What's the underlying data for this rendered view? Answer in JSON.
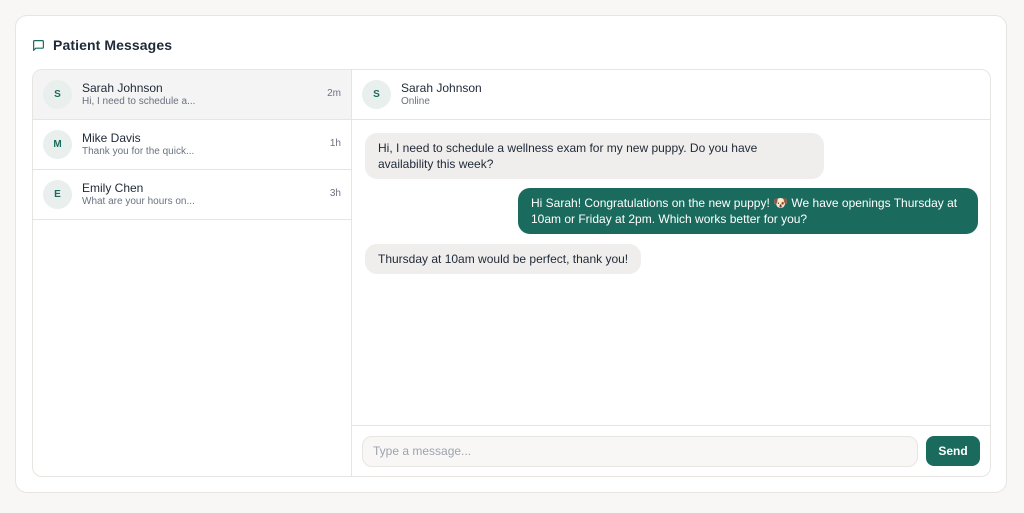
{
  "header": {
    "title": "Patient Messages",
    "icon": "message-square-icon"
  },
  "conversations": [
    {
      "initial": "S",
      "name": "Sarah Johnson",
      "preview": "Hi, I need to schedule a...",
      "time": "2m",
      "active": true
    },
    {
      "initial": "M",
      "name": "Mike Davis",
      "preview": "Thank you for the quick...",
      "time": "1h",
      "active": false
    },
    {
      "initial": "E",
      "name": "Emily Chen",
      "preview": "What are your hours on...",
      "time": "3h",
      "active": false
    }
  ],
  "chat": {
    "contact": {
      "initial": "S",
      "name": "Sarah Johnson",
      "status": "Online"
    },
    "messages": [
      {
        "direction": "in",
        "text": "Hi, I need to schedule a wellness exam for my new puppy. Do you have availability this week?"
      },
      {
        "direction": "out",
        "text": "Hi Sarah! Congratulations on the new puppy! 🐶 We have openings Thursday at 10am or Friday at 2pm. Which works better for you?"
      },
      {
        "direction": "in",
        "text": "Thursday at 10am would be perfect, thank you!"
      }
    ]
  },
  "composer": {
    "placeholder": "Type a message...",
    "send_label": "Send"
  },
  "colors": {
    "accent": "#1a6b5d",
    "incoming_bubble": "#efeeec",
    "avatar_bg": "#e8efec"
  }
}
